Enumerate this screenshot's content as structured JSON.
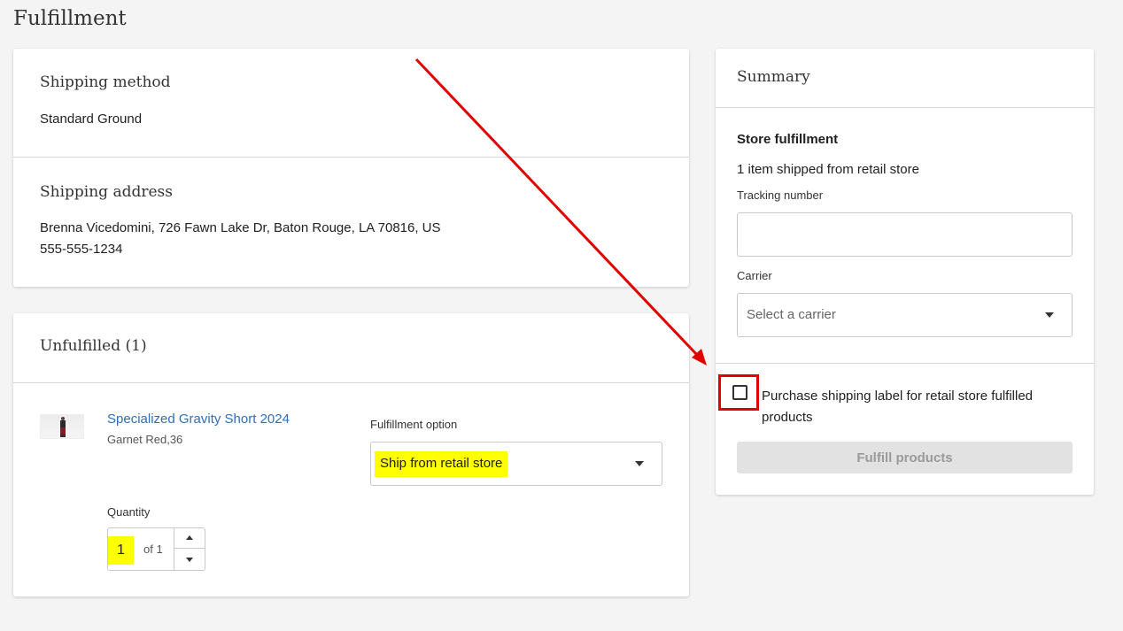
{
  "page": {
    "title": "Fulfillment"
  },
  "shipping_method": {
    "title": "Shipping method",
    "value": "Standard Ground"
  },
  "shipping_address": {
    "title": "Shipping address",
    "line1": "Brenna Vicedomini, 726 Fawn Lake Dr, Baton Rouge, LA 70816, US",
    "phone": "555-555-1234"
  },
  "unfulfilled": {
    "title": "Unfulfilled (1)",
    "item": {
      "name": "Specialized Gravity Short 2024",
      "variant": "Garnet Red,36",
      "fulfillment_label": "Fulfillment option",
      "fulfillment_value": "Ship from retail store",
      "quantity_label": "Quantity",
      "quantity_value": "1",
      "quantity_of": "of 1"
    }
  },
  "summary": {
    "title": "Summary",
    "section_title": "Store fulfillment",
    "items_text": "1 item shipped from retail store",
    "tracking_label": "Tracking number",
    "tracking_value": "",
    "carrier_label": "Carrier",
    "carrier_placeholder": "Select a carrier",
    "checkbox_label": "Purchase shipping label for retail store fulfilled products",
    "checkbox_checked": false,
    "fulfill_button": "Fulfill products"
  },
  "colors": {
    "link": "#2f6fb6",
    "highlight": "#ffff00",
    "annotation": "#e00000",
    "disabled_button": "#e2e2e2"
  },
  "icons": [
    "chevron-down-icon",
    "stepper-up-icon",
    "stepper-down-icon",
    "annotation-arrow-icon"
  ]
}
